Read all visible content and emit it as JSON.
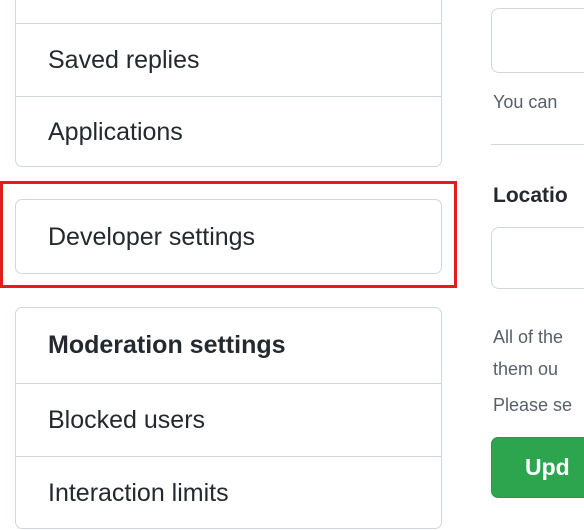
{
  "sidebar": {
    "top_items": [
      "Saved replies",
      "Applications"
    ],
    "developer_settings": "Developer settings",
    "moderation": {
      "heading": "Moderation settings",
      "items": [
        "Blocked users",
        "Interaction limits"
      ]
    }
  },
  "main": {
    "helper_text": "You can",
    "location_heading": "Locatio",
    "info_lines": [
      "All of the",
      "them ou",
      "Please se"
    ],
    "update_button": "Upd"
  },
  "colors": {
    "highlight": "#e01e1e",
    "button": "#2da44e"
  }
}
